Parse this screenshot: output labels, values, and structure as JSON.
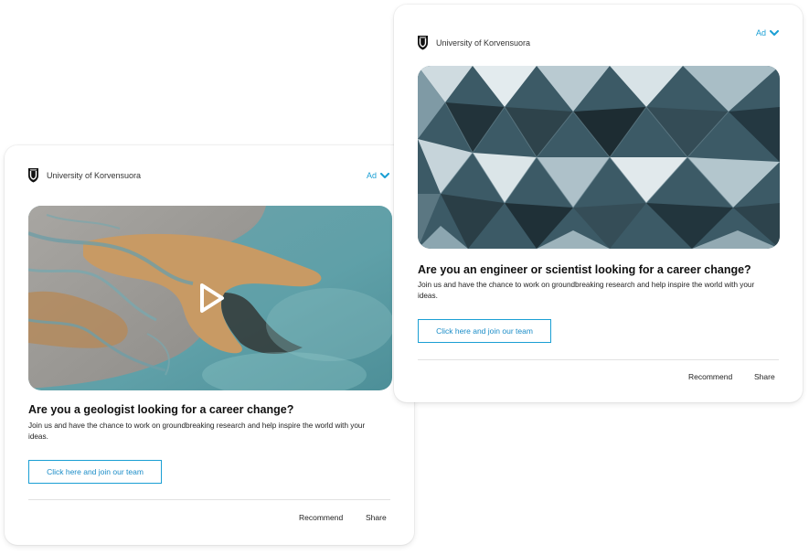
{
  "left_card": {
    "org_name": "University of Korvensuora",
    "ad_label": "Ad",
    "headline": "Are you a geologist looking for a career change?",
    "body": "Join us and have the chance to work on groundbreaking research and help inspire the world with your ideas.",
    "cta_label": "Click here and join our team",
    "recommend_label": "Recommend",
    "share_label": "Share",
    "media_icon": "play-icon"
  },
  "right_card": {
    "org_name": "University of Korvensuora",
    "ad_label": "Ad",
    "headline": "Are you an engineer or scientist looking for a career change?",
    "body": "Join us and have the chance to work on groundbreaking research and help inspire the world with your ideas.",
    "cta_label": "Click here and join our team",
    "recommend_label": "Recommend",
    "share_label": "Share"
  },
  "colors": {
    "accent": "#1a9fd4",
    "text": "#1a1a1a",
    "divider": "#e2e2e2"
  }
}
